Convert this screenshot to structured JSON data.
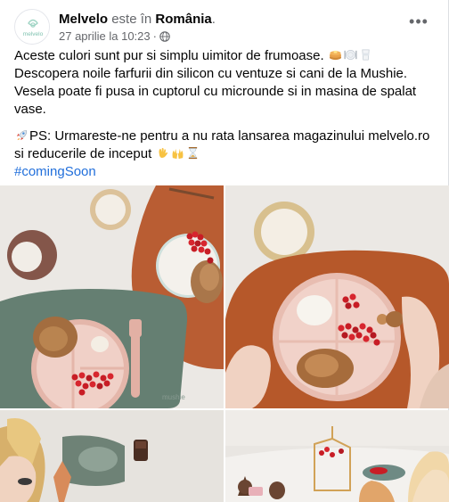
{
  "post": {
    "author": "Melvelo",
    "location_prefix": "este în",
    "location": "România",
    "location_suffix": ".",
    "timestamp": "27 aprilie la 10:23",
    "dot": "·",
    "avatar_text": "melvelo",
    "more_label": "•••",
    "body_line1": "Aceste culori sunt pur si simplu uimitor de frumoase.",
    "body_line2": "Descopera noile farfurii din silicon cu ventuze si cani de la Mushie. Vesela poate fi pusa in cuptorul cu microunde si in masina de spalat vase.",
    "ps_text": "PS: Urmareste-ne pentru a nu rata lansarea magazinului melvelo.ro si reducerile de inceput",
    "hashtag": "#comingSoon",
    "photo_brand": "mushie"
  },
  "icons": {
    "globe": "globe-icon",
    "more": "more-options-icon",
    "emoji_pancake": "pancakes-emoji",
    "emoji_plate": "fork-knife-plate-emoji",
    "emoji_cup": "cup-emoji",
    "emoji_rocket": "rocket-emoji",
    "emoji_wave": "waving-hand-emoji",
    "emoji_hands": "raising-hands-emoji",
    "emoji_hourglass": "hourglass-emoji"
  },
  "colors": {
    "hashtag": "#216fdb",
    "secondary_text": "#65676b"
  }
}
